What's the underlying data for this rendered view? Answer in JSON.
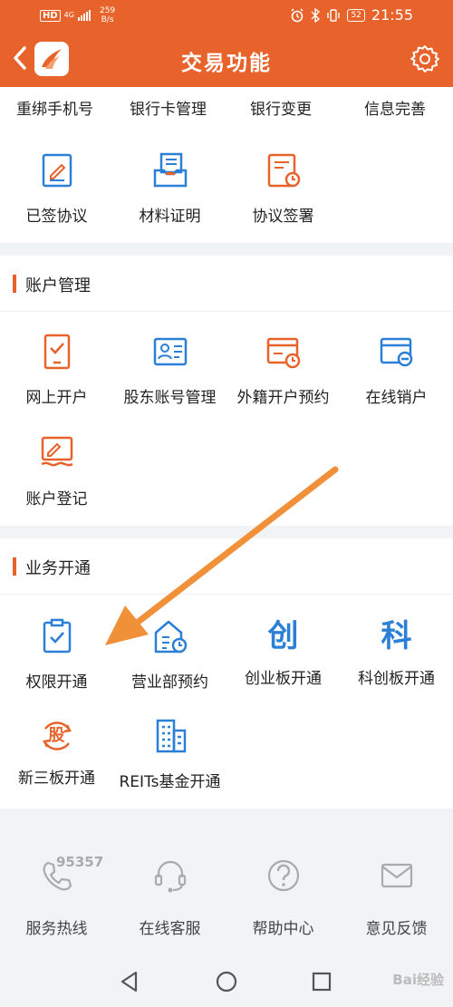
{
  "status_bar": {
    "hd": "HD",
    "network": "4G",
    "speed_value": "259",
    "speed_unit": "B/s",
    "battery": "52",
    "time": "21:55"
  },
  "header": {
    "title": "交易功能"
  },
  "top_row": {
    "items": [
      "重绑手机号",
      "银行卡管理",
      "银行变更",
      "信息完善"
    ]
  },
  "top_section": {
    "items": [
      {
        "label": "已签协议",
        "icon": "signed-agreement-icon"
      },
      {
        "label": "材料证明",
        "icon": "material-proof-icon"
      },
      {
        "label": "协议签署",
        "icon": "agreement-sign-icon"
      }
    ]
  },
  "account_section": {
    "title": "账户管理",
    "items": [
      {
        "label": "网上开户",
        "icon": "online-account-icon"
      },
      {
        "label": "股东账号管理",
        "icon": "shareholder-account-icon"
      },
      {
        "label": "外籍开户预约",
        "icon": "foreign-account-icon"
      },
      {
        "label": "在线销户",
        "icon": "close-account-icon"
      },
      {
        "label": "账户登记",
        "icon": "account-register-icon"
      }
    ]
  },
  "business_section": {
    "title": "业务开通",
    "items": [
      {
        "label": "权限开通",
        "icon": "permission-icon"
      },
      {
        "label": "营业部预约",
        "icon": "branch-appointment-icon"
      },
      {
        "label": "创业板开通",
        "icon": "chinext-icon",
        "glyph": "创"
      },
      {
        "label": "科创板开通",
        "icon": "star-market-icon",
        "glyph": "科"
      },
      {
        "label": "新三板开通",
        "icon": "neeq-icon",
        "glyph": "股"
      },
      {
        "label": "REITs基金开通",
        "icon": "reits-icon"
      }
    ]
  },
  "footer": {
    "hotline_number": "95357",
    "items": [
      {
        "label": "服务热线",
        "icon": "phone-icon"
      },
      {
        "label": "在线客服",
        "icon": "headset-icon"
      },
      {
        "label": "帮助中心",
        "icon": "help-icon"
      },
      {
        "label": "意见反馈",
        "icon": "mail-icon"
      }
    ]
  },
  "watermark": "Bai经验",
  "colors": {
    "brand": "#e8632b",
    "blue_icon": "#2c7fd6",
    "orange_icon": "#e8632b",
    "arrow": "#f0913a"
  }
}
